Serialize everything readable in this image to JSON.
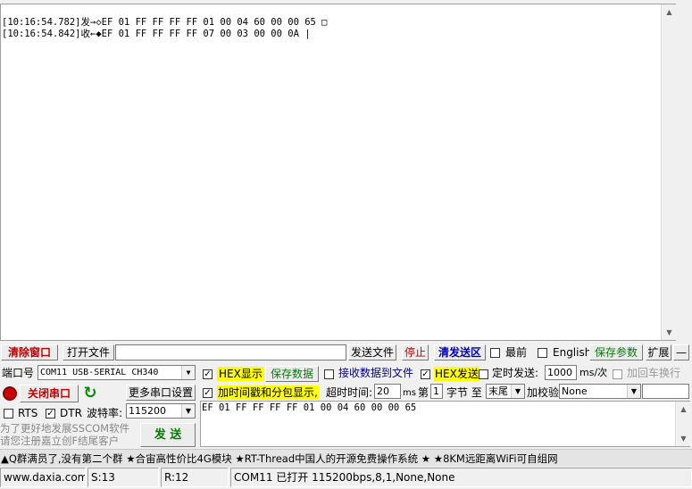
{
  "receive": {
    "lines": [
      "[10:16:54.782]发→◇EF 01 FF FF FF FF 01 00 04 60 00 00 65 □",
      "[10:16:54.842]收←◆EF 01 FF FF FF FF 07 00 03 00 00 0A |"
    ]
  },
  "toolbar": {
    "clear_window": "清除窗口",
    "open_file": "打开文件",
    "file_path": "",
    "send_file": "发送文件",
    "stop": "停止",
    "clear_send": "清发送区",
    "topmost": "最前",
    "english": "English",
    "save_params": "保存参数",
    "expand": "扩展",
    "collapse": "—"
  },
  "port": {
    "label": "端口号",
    "value": "COM11 USB-SERIAL CH340",
    "close_port": "关闭串口",
    "more_settings": "更多串口设置",
    "rts": "RTS",
    "dtr": "DTR",
    "baud_label": "波特率:",
    "baud_value": "115200"
  },
  "options": {
    "hex_display": "HEX显示",
    "save_data": "保存数据",
    "recv_to_file": "接收数据到文件",
    "timestamp": "加时间戳和分包显示,",
    "timeout_label": "超时时间:",
    "timeout_value": "20",
    "timeout_unit": "ms",
    "byte_prefix": "第",
    "byte_index": "1",
    "byte_label": "字节 至",
    "byte_end": "末尾",
    "checksum_label": "加校验",
    "checksum_value": "None",
    "hex_send": "HEX发送",
    "timed_send": "定时发送:",
    "interval": "1000",
    "interval_unit": "ms/次",
    "add_crlf": "加回车换行"
  },
  "send": {
    "text": "EF 01 FF FF FF FF 01 00 04 60 00 00 65",
    "button": "发  送",
    "promo_line1": "为了更好地发展SSCOM软件",
    "promo_line2": "请您注册嘉立创F结尾客户"
  },
  "ticker": "▲Q群满员了,没有第二个群  ★合宙高性价比4G模块  ★RT-Thread中国人的开源免费操作系统  ★  ★8KM远距离WiFi可自组网",
  "statusbar": {
    "site": "www.daxia.com",
    "sent": "S:13",
    "received": "R:12",
    "port_status": "COM11 已打开  115200bps,8,1,None,None"
  }
}
